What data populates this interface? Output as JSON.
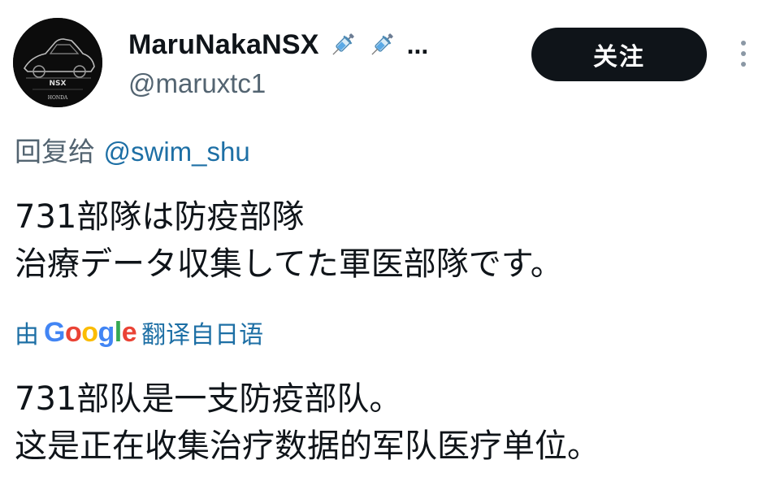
{
  "user": {
    "display_name": "MaruNakaNSX",
    "name_emoji": [
      "syringe-emoji",
      "syringe-emoji"
    ],
    "ellipsis": "...",
    "handle": "@maruxtc1",
    "avatar_text_top": "NSX",
    "avatar_text_bottom": "HONDA"
  },
  "actions": {
    "follow_label": "关注",
    "more_icon": "vertical-ellipsis-icon"
  },
  "reply": {
    "prefix": "回复给",
    "mention": "@swim_shu"
  },
  "tweet": {
    "lines": [
      "731部隊は防疫部隊",
      "治療データ収集してた軍医部隊です。"
    ]
  },
  "translation": {
    "prefix": "由",
    "google_letters": [
      "G",
      "o",
      "o",
      "g",
      "l",
      "e"
    ],
    "suffix": "翻译自日语",
    "lines": [
      "731部队是一支防疫部队。",
      "这是正在收集治疗数据的军队医疗单位。"
    ]
  },
  "colors": {
    "follow_button_bg": "#0f1419",
    "secondary_text": "#536471",
    "link": "#1d6fa5"
  }
}
